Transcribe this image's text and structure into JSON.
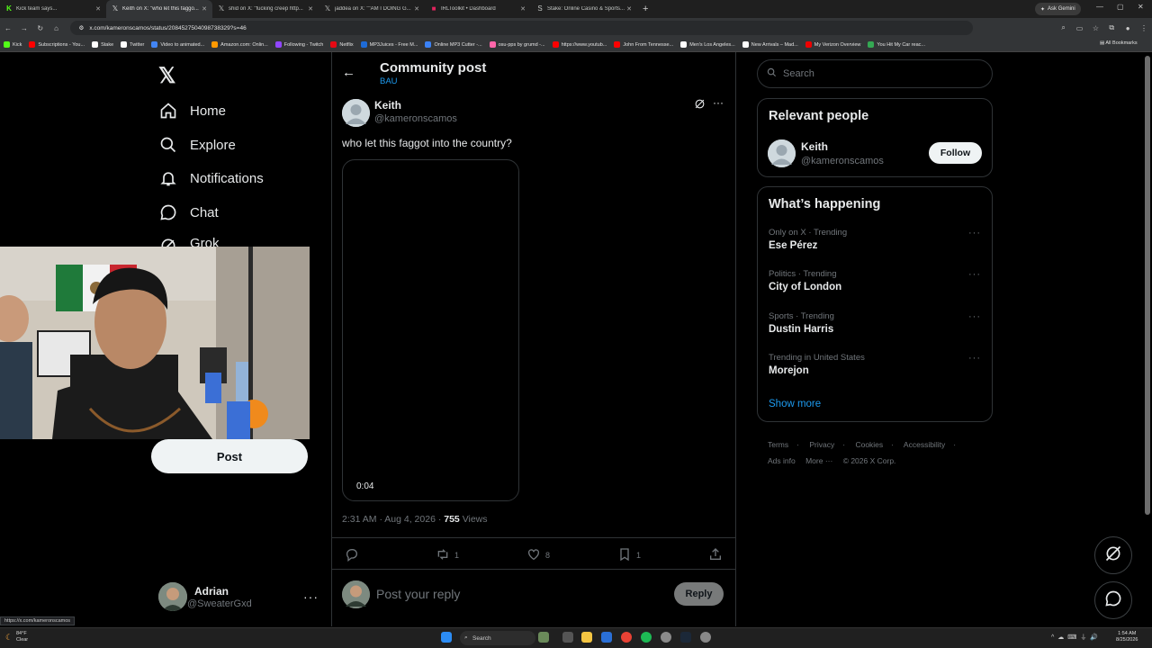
{
  "browser": {
    "tabs": [
      {
        "title": "Kick team says...",
        "icon": "kick-icon",
        "active": false
      },
      {
        "title": "Keith on X: \"who let this faggo...",
        "icon": "x-logo-icon",
        "active": true
      },
      {
        "title": "shid on X: \"fucking creep http...",
        "icon": "x-logo-icon",
        "active": false
      },
      {
        "title": "jaddea on X: \"\"AM I DOING G...",
        "icon": "x-logo-icon",
        "active": false
      },
      {
        "title": "IRLToolkit • Dashboard",
        "icon": "irltoolkit-icon",
        "active": false
      },
      {
        "title": "Stake: Online Casino & Sports...",
        "icon": "stake-icon",
        "active": false
      }
    ],
    "ask_gemini": "Ask Gemini",
    "url": "x.com/kameronscamos/status/2084527504098738329?s=46",
    "bookmarks": [
      {
        "label": "Kick",
        "color": "#53fc18"
      },
      {
        "label": "Subscriptions - You...",
        "color": "#ff0000"
      },
      {
        "label": "Stake",
        "color": "#ffffff"
      },
      {
        "label": "Twitter",
        "color": "#ffffff"
      },
      {
        "label": "Video to animated...",
        "color": "#4285f4"
      },
      {
        "label": "Amazon.com: Onlin...",
        "color": "#ff9900"
      },
      {
        "label": "Following - Twitch",
        "color": "#9146ff"
      },
      {
        "label": "Netflix",
        "color": "#e50914"
      },
      {
        "label": "MP3Juices - Free M...",
        "color": "#1e6bd6"
      },
      {
        "label": "Online MP3 Cutter -...",
        "color": "#3b82f6"
      },
      {
        "label": "osu-pps by grumd -...",
        "color": "#ff66aa"
      },
      {
        "label": "https://www.youtub...",
        "color": "#ff0000"
      },
      {
        "label": "John From Tennesse...",
        "color": "#ff0000"
      },
      {
        "label": "Men's Los Angeles...",
        "color": "#ffffff"
      },
      {
        "label": "New Arrivals – Mad...",
        "color": "#ffffff"
      },
      {
        "label": "My Verizon Overview",
        "color": "#ee0000"
      },
      {
        "label": "You Hit My Car reac...",
        "color": "#34a853"
      }
    ],
    "all_bookmarks": "All Bookmarks",
    "status_url": "https://x.com/kameronscamos"
  },
  "sidebar": {
    "items": [
      {
        "label": "Home",
        "icon": "home-icon"
      },
      {
        "label": "Explore",
        "icon": "search-icon"
      },
      {
        "label": "Notifications",
        "icon": "bell-icon"
      },
      {
        "label": "Chat",
        "icon": "chat-icon"
      },
      {
        "label": "Grok",
        "icon": "grok-icon"
      }
    ],
    "post_label": "Post",
    "user": {
      "name": "Adrian",
      "handle": "@SweaterGxd"
    }
  },
  "header": {
    "title": "Community post",
    "community": "BAU"
  },
  "post": {
    "author": "Keith",
    "handle": "@kameronscamos",
    "text": "who let this faggot into the country?",
    "video_time": "0:04",
    "timestamp": "2:31 AM · Aug 4, 2026 · ",
    "views_count": "755",
    "views_label": " Views",
    "retweets": "1",
    "likes": "8",
    "bookmarks": "1"
  },
  "reply": {
    "placeholder": "Post your reply",
    "button": "Reply"
  },
  "right": {
    "search_placeholder": "Search",
    "relevant_title": "Relevant people",
    "relevant_person": {
      "name": "Keith",
      "handle": "@kameronscamos",
      "follow": "Follow"
    },
    "happening_title": "What’s happening",
    "trends": [
      {
        "context": "Only on X · Trending",
        "name": "Ese Pérez"
      },
      {
        "context": "Politics · Trending",
        "name": "City of London"
      },
      {
        "context": "Sports · Trending",
        "name": "Dustin Harris"
      },
      {
        "context": "Trending in United States",
        "name": "Morejon"
      }
    ],
    "show_more": "Show more",
    "footer": [
      "Terms",
      "Privacy",
      "Cookies",
      "Accessibility",
      "Ads info",
      "More ···",
      "© 2026 X Corp."
    ]
  },
  "taskbar": {
    "weather_temp": "84°F",
    "weather_desc": "Clear",
    "search": "Search",
    "time": "1:54 AM",
    "date": "8/25/2026"
  },
  "colors": {
    "accent": "#1d9bf0",
    "border": "#2f3336",
    "muted": "#71767b",
    "text": "#e7e9ea"
  }
}
